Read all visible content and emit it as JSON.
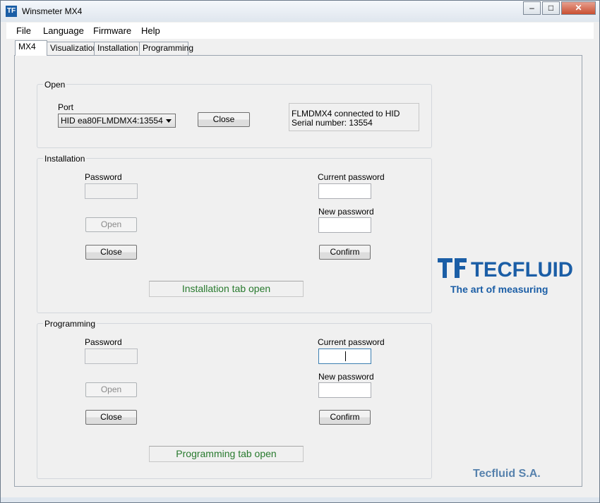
{
  "window": {
    "title": "Winsmeter MX4",
    "icon_text": "TF",
    "min_glyph": "–",
    "max_glyph": "□",
    "close_glyph": "✕"
  },
  "menu": {
    "items": [
      "File",
      "Language",
      "Firmware",
      "Help"
    ]
  },
  "tabs": [
    "MX4",
    "Visualization",
    "Installation",
    "Programming"
  ],
  "open_group": {
    "label": "Open",
    "port_label": "Port",
    "port_value": "HID ea80FLMDMX4:13554",
    "close_button": "Close",
    "status_line1": "FLMDMX4 connected to HID",
    "status_line2": "Serial number: 13554"
  },
  "installation": {
    "label": "Installation",
    "password_label": "Password",
    "password_value": "",
    "open_button": "Open",
    "close_button": "Close",
    "current_password_label": "Current password",
    "current_password_value": "",
    "new_password_label": "New password",
    "new_password_value": "",
    "confirm_button": "Confirm",
    "status": "Installation tab open"
  },
  "programming": {
    "label": "Programming",
    "password_label": "Password",
    "password_value": "",
    "open_button": "Open",
    "close_button": "Close",
    "current_password_label": "Current password",
    "current_password_value": "",
    "new_password_label": "New password",
    "new_password_value": "",
    "confirm_button": "Confirm",
    "status": "Programming tab open"
  },
  "branding": {
    "logo_text": "TECFLUID",
    "slogan": "The art of measuring",
    "company": "Tecfluid S.A."
  },
  "colors": {
    "brand": "#1b5ea6",
    "status_text": "#287a2e",
    "company_text": "#5782ad"
  }
}
